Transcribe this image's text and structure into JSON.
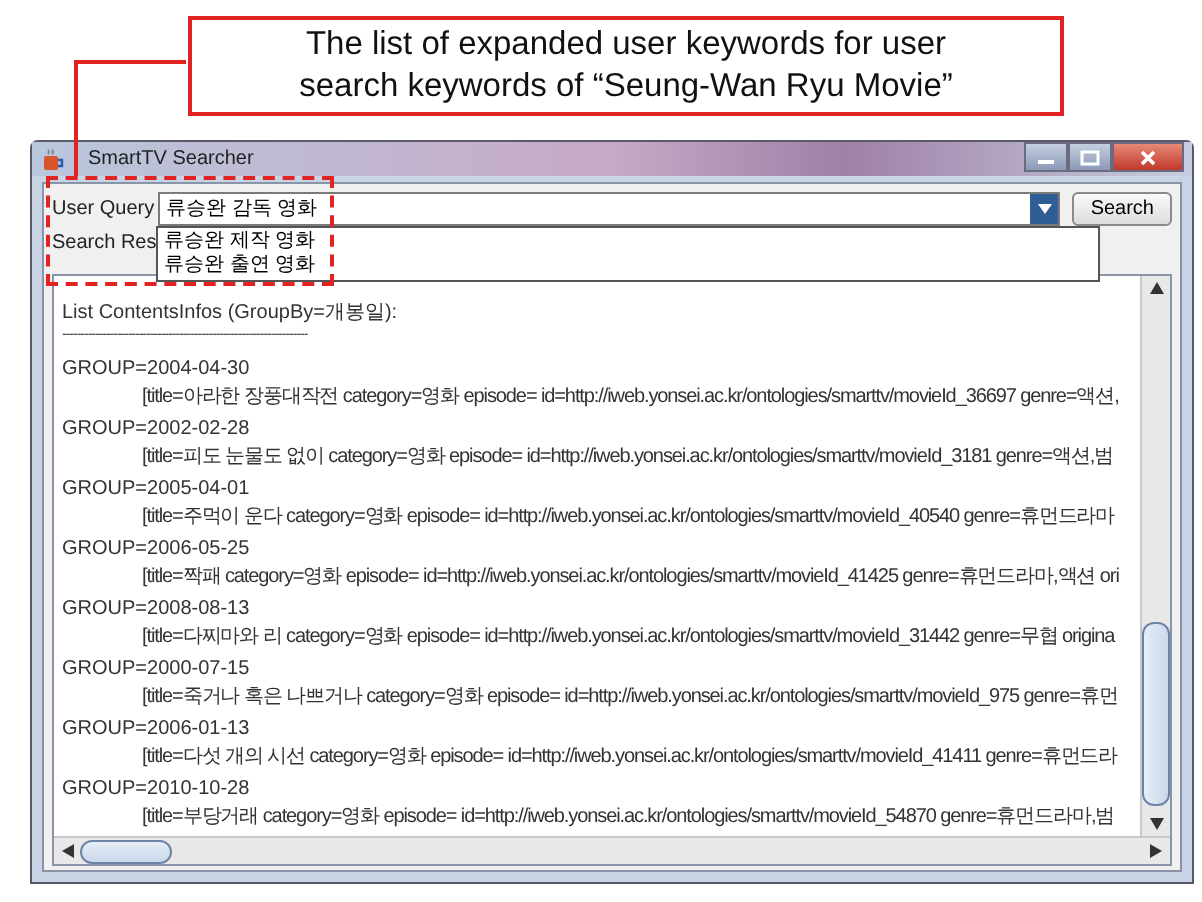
{
  "callout": {
    "lines": [
      "The list of expanded user keywords for user",
      "search keywords of “Seung-Wan Ryu Movie”"
    ]
  },
  "window": {
    "title": "SmartTV Searcher"
  },
  "query": {
    "label": "User Query",
    "value": "류승완 감독 영화",
    "button": "Search"
  },
  "dropdown": {
    "items": [
      "류승완 제작 영화",
      "류승완 출연 영화"
    ]
  },
  "results_label": "Search Res",
  "results": {
    "header": "List ContentsInfos (GroupBy=개봉일):",
    "separator": "-------------------------------------------------------------------",
    "groups": [
      {
        "group": "GROUP=2004-04-30",
        "line": "[title=아라한 장풍대작전 category=영화 episode= id=http://iweb.yonsei.ac.kr/ontologies/smarttv/movieId_36697 genre=액션,"
      },
      {
        "group": "GROUP=2002-02-28",
        "line": "[title=피도 눈물도 없이 category=영화 episode= id=http://iweb.yonsei.ac.kr/ontologies/smarttv/movieId_3181 genre=액션,범"
      },
      {
        "group": "GROUP=2005-04-01",
        "line": "[title=주먹이 운다 category=영화 episode= id=http://iweb.yonsei.ac.kr/ontologies/smarttv/movieId_40540 genre=휴먼드라마"
      },
      {
        "group": "GROUP=2006-05-25",
        "line": "[title=짝패 category=영화 episode= id=http://iweb.yonsei.ac.kr/ontologies/smarttv/movieId_41425 genre=휴먼드라마,액션 ori"
      },
      {
        "group": "GROUP=2008-08-13",
        "line": "[title=다찌마와 리 category=영화 episode= id=http://iweb.yonsei.ac.kr/ontologies/smarttv/movieId_31442 genre=무협 origina"
      },
      {
        "group": "GROUP=2000-07-15",
        "line": "[title=죽거나 혹은 나쁘거나 category=영화 episode= id=http://iweb.yonsei.ac.kr/ontologies/smarttv/movieId_975 genre=휴먼"
      },
      {
        "group": "GROUP=2006-01-13",
        "line": "[title=다섯 개의 시선 category=영화 episode= id=http://iweb.yonsei.ac.kr/ontologies/smarttv/movieId_41411 genre=휴먼드라"
      },
      {
        "group": "GROUP=2010-10-28",
        "line": "[title=부당거래 category=영화 episode= id=http://iweb.yonsei.ac.kr/ontologies/smarttv/movieId_54870 genre=휴먼드라마,범"
      }
    ]
  }
}
